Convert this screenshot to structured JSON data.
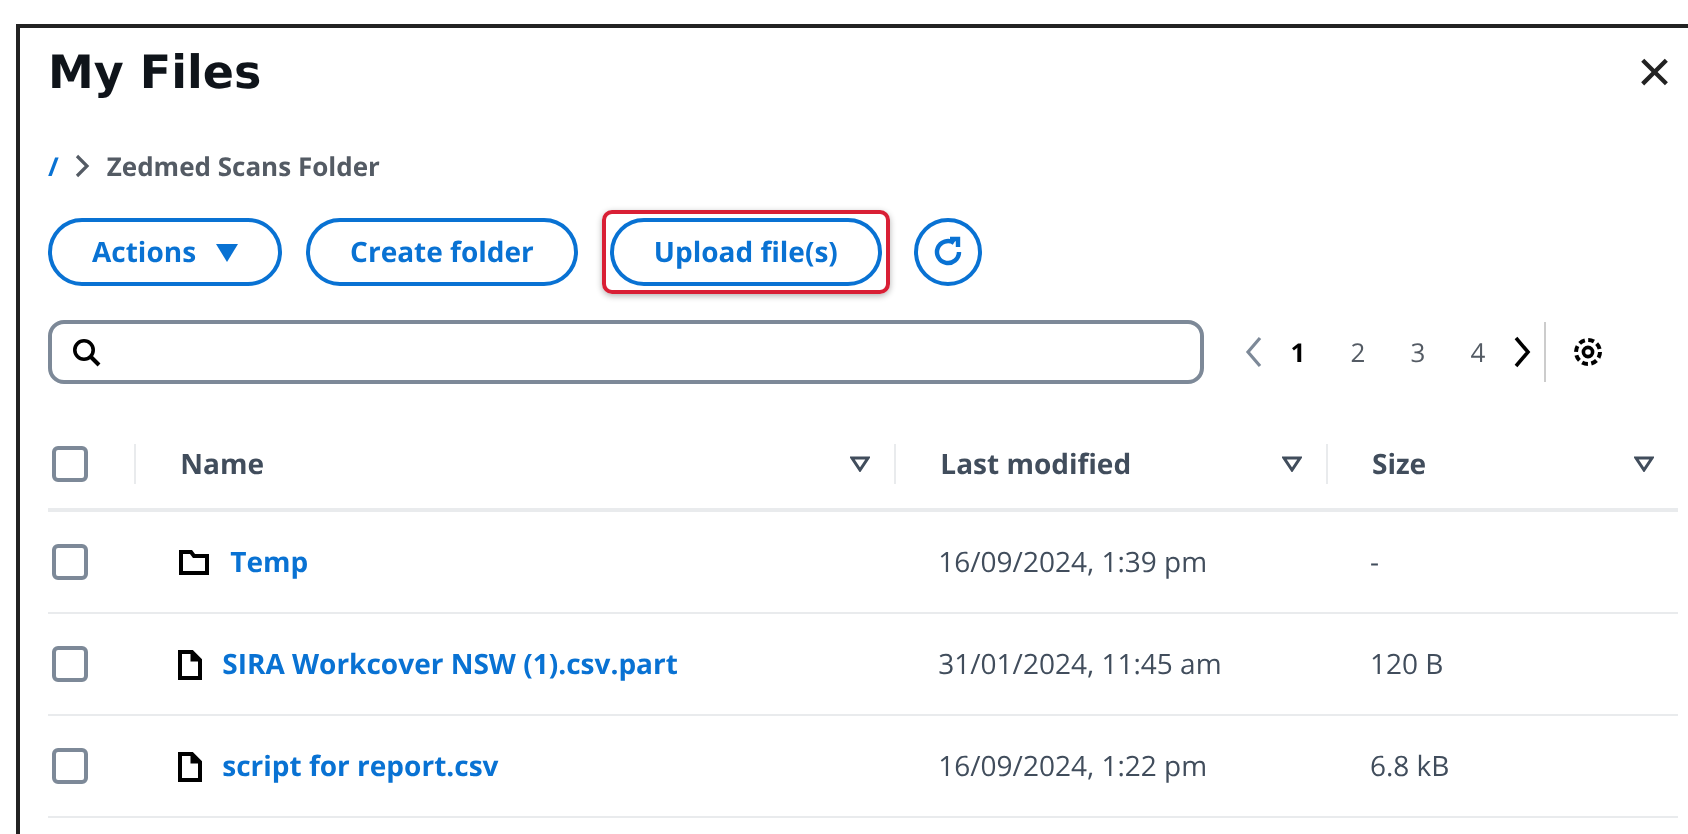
{
  "window": {
    "title": "My Files",
    "close": "×"
  },
  "breadcrumb": [
    "/",
    "Zedmed Scans Folder"
  ],
  "toolbar": [
    {
      "kind": "dropdown",
      "label": "Actions",
      "highlighted": false
    },
    {
      "kind": "button",
      "label": "Create folder",
      "highlighted": false
    },
    {
      "kind": "button",
      "label": "Upload file(s)",
      "highlighted": true
    },
    {
      "kind": "refresh",
      "highlighted": false
    }
  ],
  "pagination": {
    "pages": [
      {
        "label": "1",
        "selected": true
      },
      {
        "label": "2",
        "selected": false
      },
      {
        "label": "3",
        "selected": false
      },
      {
        "label": "4",
        "selected": false
      }
    ]
  },
  "table": {
    "select_all_checked": false,
    "columns": [
      "Name",
      "Last modified",
      "Size"
    ],
    "rows": [
      {
        "kind": "folder",
        "name": "Temp",
        "modified": "16/09/2024, 1:39 pm",
        "size": "-",
        "checked": false
      },
      {
        "kind": "file",
        "name": "SIRA Workcover NSW (1).csv.part",
        "modified": "31/01/2024, 11:45 am",
        "size": "120 B",
        "checked": false
      },
      {
        "kind": "file",
        "name": "script for report.csv",
        "modified": "16/09/2024, 1:22 pm",
        "size": "6.8 kB",
        "checked": false
      }
    ]
  }
}
